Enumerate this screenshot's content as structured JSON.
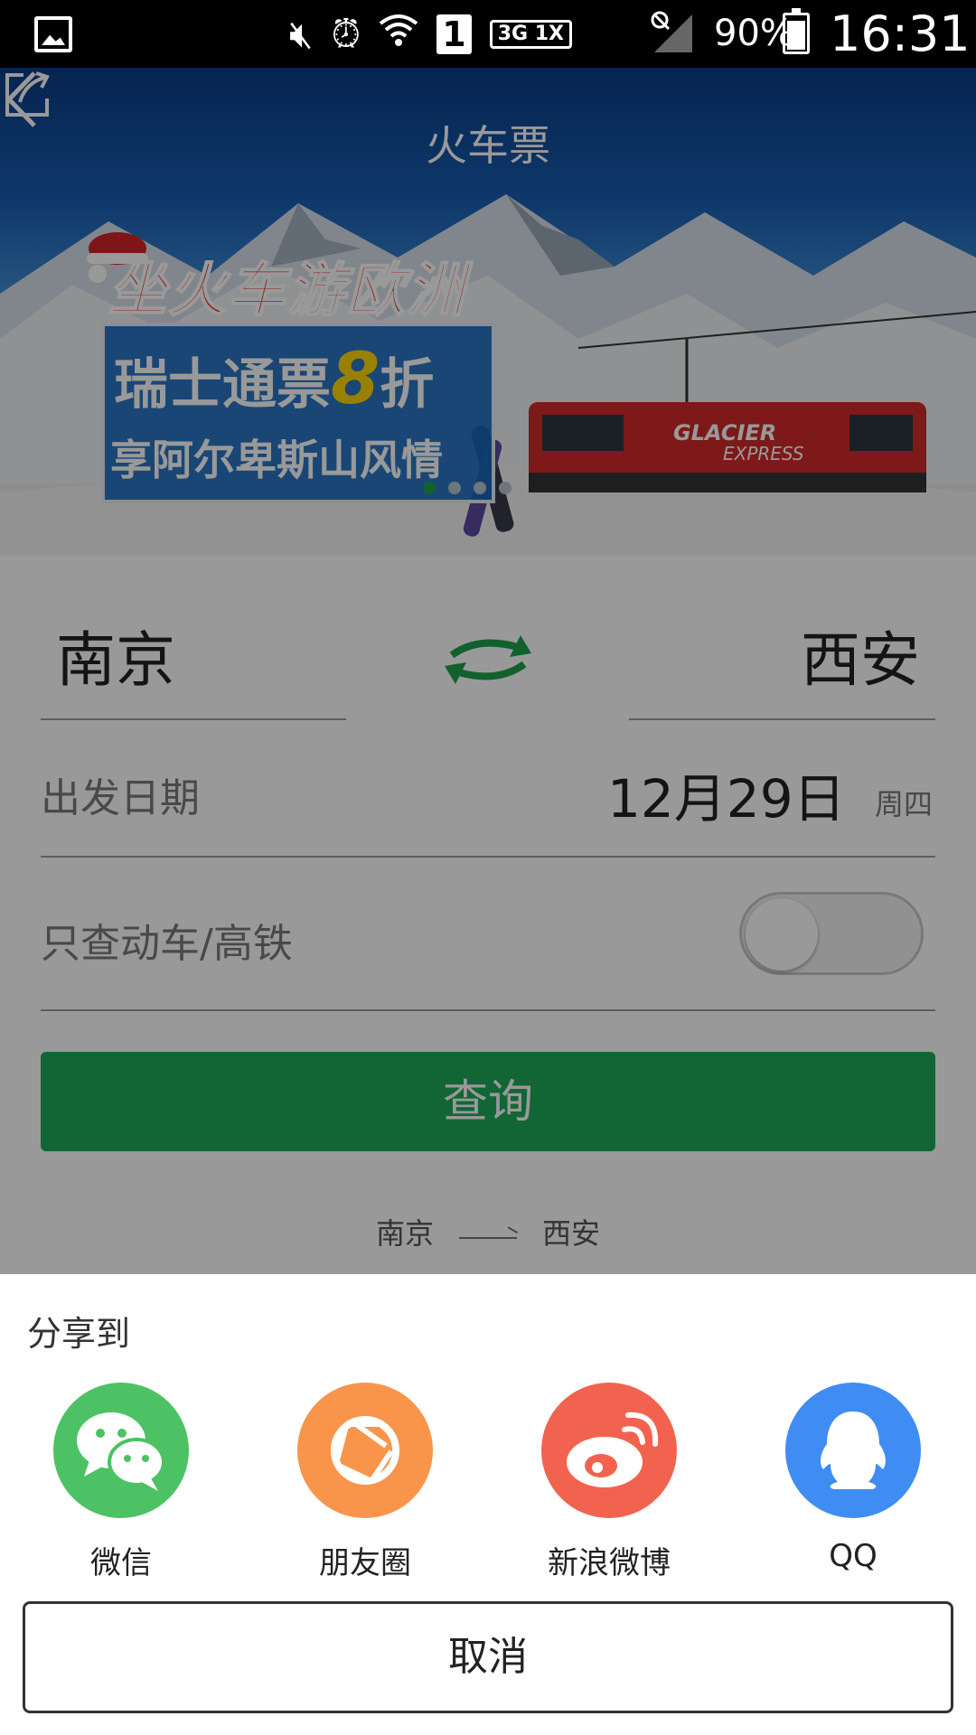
{
  "status_bar": {
    "battery_pct": "90%",
    "battery_level": 0.9,
    "time": "16:31",
    "sim_badge": "1",
    "network_badge": "3G 1X"
  },
  "nav": {
    "title": "火车票",
    "back_icon": "chevron-left-icon",
    "share_icon": "share-external-icon"
  },
  "banner": {
    "title": "坐火车游欧洲",
    "line1_prefix": "瑞士通票",
    "line1_highlight": "8",
    "line1_suffix": "折",
    "line2": "享阿尔卑斯山风情",
    "train_logo": "GLACIER EXPRESS",
    "active_slide": 1,
    "slide_count": 4
  },
  "search": {
    "from_city": "南京",
    "to_city": "西安",
    "swap_icon": "swap-arrows-icon",
    "date_label": "出发日期",
    "date_value": "12月29日",
    "weekday": "周四",
    "filter_label": "只查动车/高铁",
    "filter_enabled": false,
    "query_button": "查询"
  },
  "history": {
    "from": "南京",
    "to": "西安"
  },
  "share_sheet": {
    "title": "分享到",
    "options": [
      {
        "label": "微信",
        "icon": "wechat-icon",
        "color": "#4cc264"
      },
      {
        "label": "朋友圈",
        "icon": "moments-icon",
        "color": "#f8954a"
      },
      {
        "label": "新浪微博",
        "icon": "weibo-icon",
        "color": "#f2634f"
      },
      {
        "label": "QQ",
        "icon": "qq-icon",
        "color": "#3f8df3"
      }
    ],
    "cancel": "取消"
  },
  "colors": {
    "accent_green": "#1eaa5a",
    "status_bar_bg": "#000000"
  }
}
